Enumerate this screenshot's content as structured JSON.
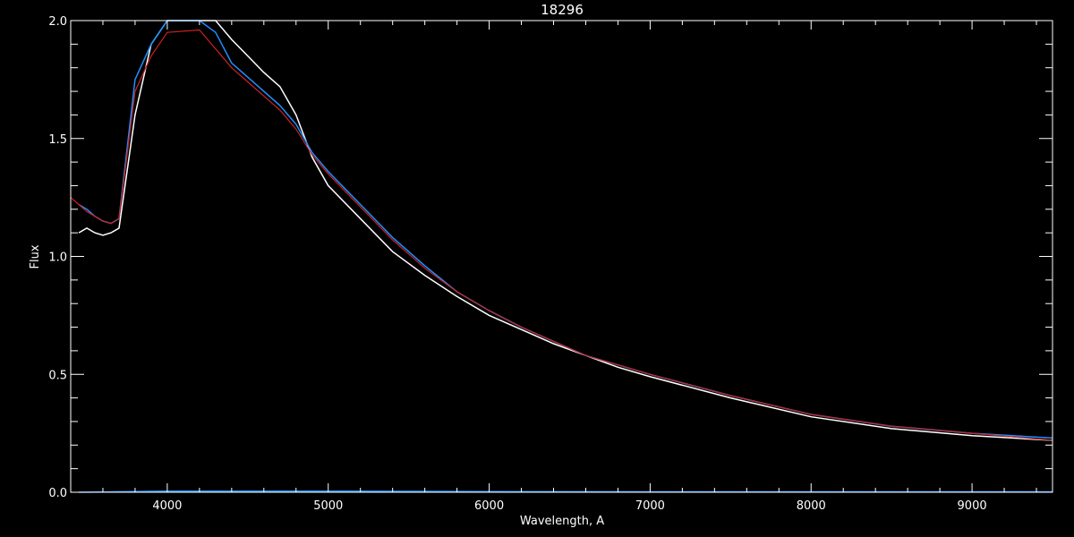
{
  "chart_data": {
    "type": "line",
    "title": "18296",
    "xlabel": "Wavelength, A",
    "ylabel": "Flux",
    "xlim": [
      3400,
      9500
    ],
    "ylim": [
      0.0,
      2.0
    ],
    "x_ticks": [
      4000,
      5000,
      6000,
      7000,
      8000,
      9000
    ],
    "x_tick_labels": [
      "4000",
      "5000",
      "6000",
      "7000",
      "8000",
      "9000"
    ],
    "y_ticks": [
      0.0,
      0.5,
      1.0,
      1.5,
      2.0
    ],
    "y_tick_labels": [
      "0.0",
      "0.5",
      "1.0",
      "1.5",
      "2.0"
    ],
    "grid": false,
    "legend": "none",
    "series": [
      {
        "color": "#ffffff",
        "x": [
          3450,
          3500,
          3550,
          3600,
          3650,
          3700,
          3800,
          3900,
          4000,
          4200,
          4300,
          4400,
          4500,
          4600,
          4700,
          4800,
          4900,
          5000,
          5200,
          5400,
          5600,
          5800,
          6000,
          6200,
          6400,
          6600,
          6800,
          7000,
          7500,
          8000,
          8500,
          9000,
          9500
        ],
        "y": [
          1.1,
          1.12,
          1.1,
          1.09,
          1.1,
          1.12,
          1.6,
          1.9,
          2.1,
          2.1,
          2.0,
          1.92,
          1.85,
          1.78,
          1.72,
          1.6,
          1.42,
          1.3,
          1.16,
          1.02,
          0.92,
          0.83,
          0.75,
          0.69,
          0.63,
          0.58,
          0.53,
          0.49,
          0.4,
          0.32,
          0.27,
          0.24,
          0.22
        ]
      },
      {
        "color": "#1e90ff",
        "x": [
          3450,
          3500,
          3550,
          3600,
          3650,
          3700,
          3800,
          3900,
          4000,
          4200,
          4300,
          4400,
          4500,
          4600,
          4700,
          4800,
          4900,
          5000,
          5200,
          5400,
          5600,
          5800,
          6000,
          6200,
          6400,
          6600,
          6800,
          7000,
          7500,
          8000,
          8500,
          9000,
          9500
        ],
        "y": [
          1.22,
          1.2,
          1.17,
          1.15,
          1.14,
          1.16,
          1.75,
          1.9,
          2.0,
          2.0,
          1.95,
          1.82,
          1.76,
          1.7,
          1.64,
          1.56,
          1.44,
          1.36,
          1.22,
          1.08,
          0.96,
          0.85,
          0.77,
          0.7,
          0.64,
          0.58,
          0.54,
          0.5,
          0.41,
          0.33,
          0.28,
          0.25,
          0.23
        ]
      },
      {
        "color": "#cc2222",
        "x": [
          3400,
          3450,
          3500,
          3550,
          3600,
          3650,
          3700,
          3800,
          3900,
          4000,
          4200,
          4300,
          4400,
          4500,
          4600,
          4700,
          4800,
          4900,
          5000,
          5200,
          5400,
          5600,
          5800,
          6000,
          6200,
          6400,
          6600,
          6800,
          7000,
          7500,
          8000,
          8500,
          9000,
          9500
        ],
        "y": [
          1.25,
          1.22,
          1.19,
          1.17,
          1.15,
          1.14,
          1.16,
          1.7,
          1.85,
          1.95,
          1.96,
          1.88,
          1.8,
          1.74,
          1.68,
          1.62,
          1.54,
          1.43,
          1.35,
          1.21,
          1.07,
          0.95,
          0.85,
          0.77,
          0.7,
          0.64,
          0.58,
          0.54,
          0.5,
          0.41,
          0.33,
          0.28,
          0.25,
          0.22
        ]
      },
      {
        "color": "#1e90ff",
        "x": [
          3450,
          4000,
          5000,
          6000,
          7000,
          8000,
          9000,
          9500
        ],
        "y": [
          0.0,
          0.005,
          0.005,
          0.003,
          0.002,
          0.002,
          0.002,
          0.002
        ]
      }
    ]
  }
}
